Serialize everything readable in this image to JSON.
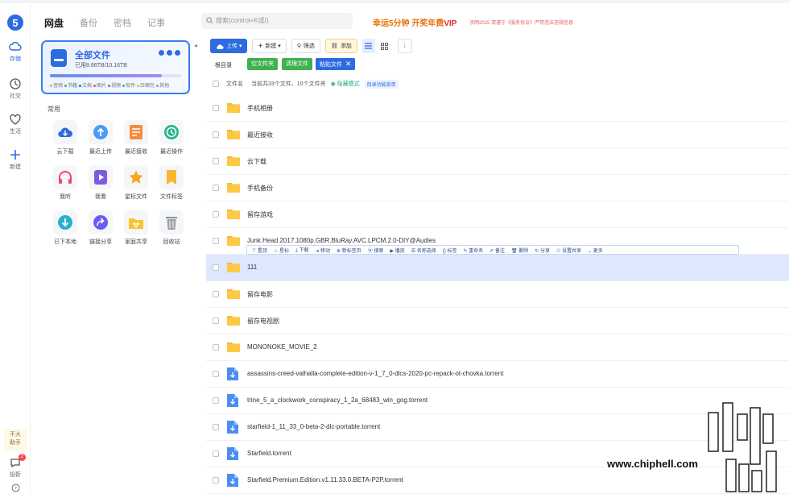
{
  "rail": {
    "items": [
      {
        "label": "存储",
        "icon": "cloud-icon"
      },
      {
        "label": "社交",
        "icon": "clock-icon"
      },
      {
        "label": "生活",
        "icon": "heart-icon"
      },
      {
        "label": "新建",
        "icon": "plus-icon"
      }
    ],
    "assistant_line1": "不大",
    "assistant_line2": "助手",
    "feedback_label": "投靳",
    "feedback_badge": "2"
  },
  "panel": {
    "tabs": [
      "网盘",
      "备份",
      "密档",
      "记事"
    ],
    "all_files": {
      "title": "全部文件",
      "used": "已用8.66TB/10.16TB",
      "usage_fraction": 0.852,
      "categories": [
        {
          "label": "音频",
          "color": "#f4a236"
        },
        {
          "label": "书籍",
          "color": "#3fb24f"
        },
        {
          "label": "文档",
          "color": "#2d6be0"
        },
        {
          "label": "图片",
          "color": "#e05a5a"
        },
        {
          "label": "视频",
          "color": "#9b59d0"
        },
        {
          "label": "软件",
          "color": "#26b3c9"
        },
        {
          "label": "压缩包",
          "color": "#f0c419"
        },
        {
          "label": "其他",
          "color": "#999999"
        }
      ]
    },
    "section_title": "常用",
    "shortcuts": [
      {
        "label": "云下载",
        "icon": "cloud-download-icon"
      },
      {
        "label": "最近上传",
        "icon": "upload-icon"
      },
      {
        "label": "最近接收",
        "icon": "inbox-icon"
      },
      {
        "label": "最近操作",
        "icon": "history-icon"
      },
      {
        "label": "我听",
        "icon": "headphones-icon"
      },
      {
        "label": "我看",
        "icon": "play-icon"
      },
      {
        "label": "星标文件",
        "icon": "star-icon"
      },
      {
        "label": "文件标签",
        "icon": "bookmark-icon"
      },
      {
        "label": "已下本地",
        "icon": "download-icon"
      },
      {
        "label": "链接分享",
        "icon": "share-icon"
      },
      {
        "label": "家庭共享",
        "icon": "family-icon"
      },
      {
        "label": "回收站",
        "icon": "trash-icon"
      }
    ]
  },
  "main": {
    "search_placeholder": "搜索(control+K或/)",
    "promo": {
      "prefix": "幸运5分钟 开奖年费",
      "vip": "VIP"
    },
    "notice": "涉网2025 请遵守《服务协议》严禁违法违规信息",
    "toolbar": {
      "upload": "上传",
      "new": "新建",
      "filter": "筛选",
      "add": "添加"
    },
    "breadcrumb": "根目录",
    "chips": [
      "空文件夹",
      "清理文件",
      "粘贴文件"
    ],
    "header": {
      "name_col": "文件名",
      "summary": "当前共33个文件、10个文件夹",
      "mode": "隐藏模式",
      "menu": "目录功能菜单"
    },
    "hover_actions": [
      "置顶",
      "星标",
      "下载",
      "移动",
      "新标签页",
      "搜索",
      "播放",
      "名称选择",
      "标签",
      "重命名",
      "备注",
      "删除",
      "分享",
      "设置共享",
      "更多"
    ],
    "files": [
      {
        "name": "手机相册",
        "type": "folder"
      },
      {
        "name": "最近接收",
        "type": "folder"
      },
      {
        "name": "云下载",
        "type": "folder"
      },
      {
        "name": "手机备份",
        "type": "folder"
      },
      {
        "name": "留存游戏",
        "type": "folder"
      },
      {
        "name": "Junk.Head.2017.1080p.GBR.BluRay.AVC.LPCM.2.0-DIY@Audies",
        "type": "folder"
      },
      {
        "name": "111",
        "type": "folder"
      },
      {
        "name": "留存电影",
        "type": "folder"
      },
      {
        "name": "留存电视剧",
        "type": "folder"
      },
      {
        "name": "MONONOKE_MOVIE_2",
        "type": "folder"
      },
      {
        "name": "assassins-creed-valhalla-complete-edition-v-1_7_0-dlcs-2020-pc-repack-ot-chovka.torrent",
        "type": "torrent"
      },
      {
        "name": "trine_5_a_clockwork_conspiracy_1_2a_68483_win_gog.torrent",
        "type": "torrent"
      },
      {
        "name": "starfield-1_11_33_0-beta-2-dlc-portable.torrent",
        "type": "torrent"
      },
      {
        "name": "Starfield.torrent",
        "type": "torrent"
      },
      {
        "name": "Starfield.Premium.Edition.v1.11.33.0.BETA-P2P.torrent",
        "type": "torrent"
      }
    ],
    "selected_index": 6
  },
  "watermark": {
    "text": "www.chiphell.com"
  },
  "colors": {
    "accent": "#2d6be0",
    "folder": "#f7b731",
    "green": "#3fb24f"
  }
}
